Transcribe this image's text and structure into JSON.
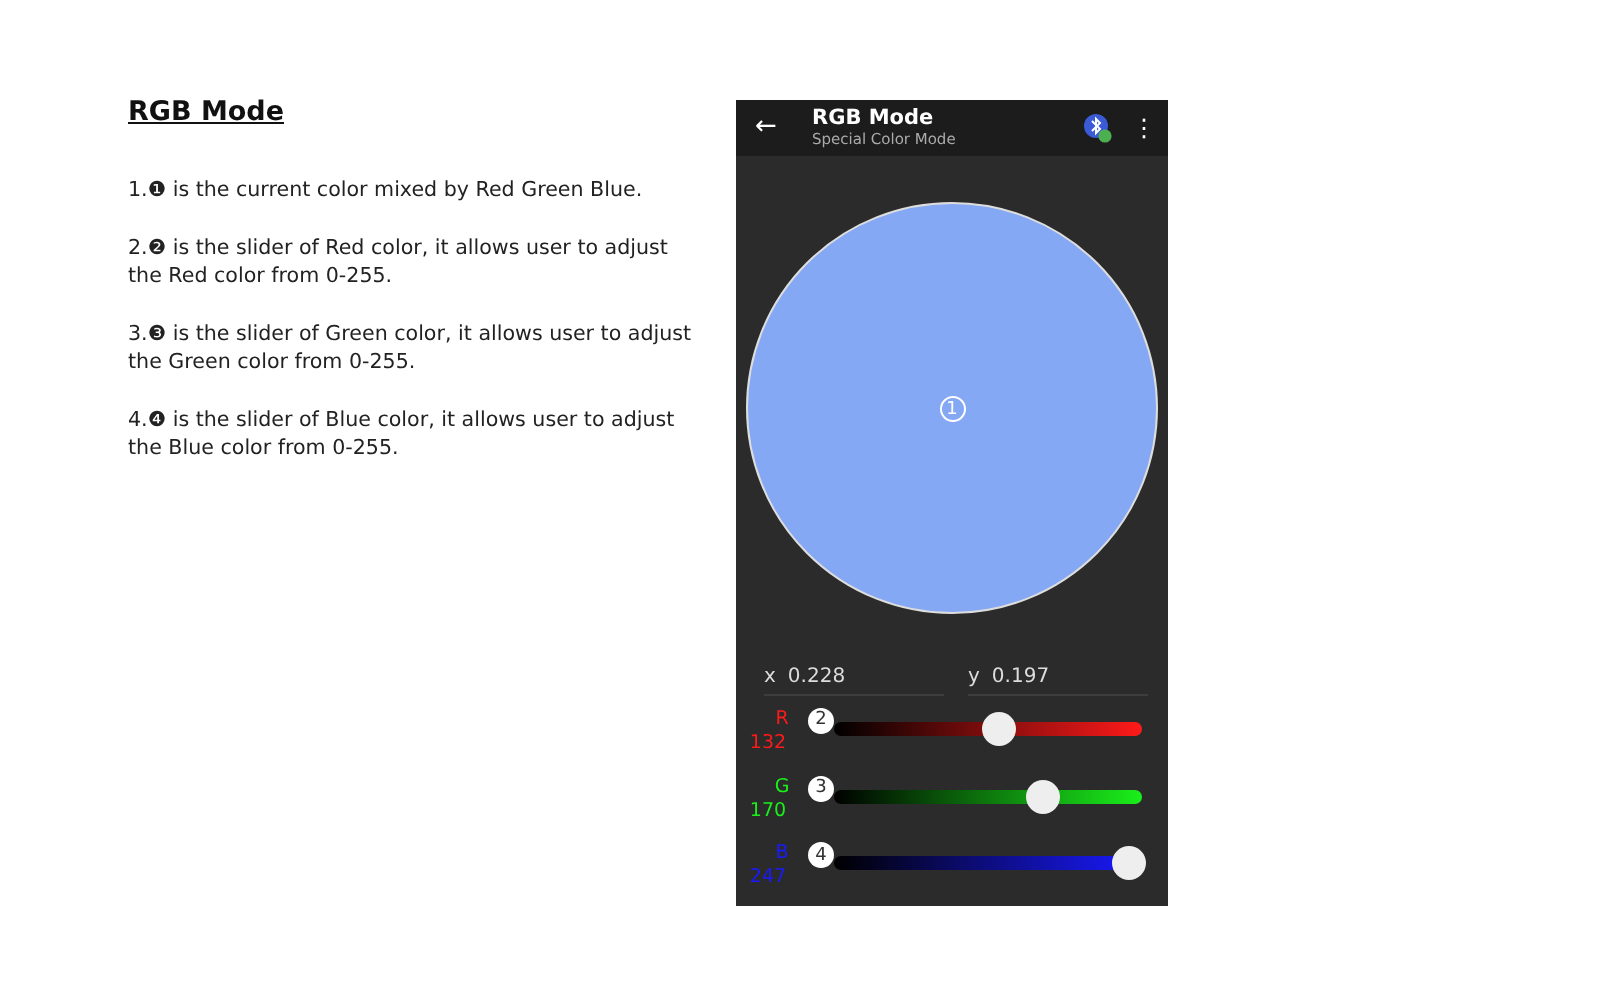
{
  "doc": {
    "title": "RGB Mode",
    "paragraphs": [
      "1.❶ is the current color mixed by Red Green Blue.",
      "2.❷ is the slider of Red color, it allows user to adjust the Red color from 0-255.",
      "3.❸ is the slider of Green color, it allows user to adjust the Green color from 0-255.",
      "4.❹ is the slider of Blue color, it allows user to adjust the Blue color from 0-255."
    ]
  },
  "app": {
    "title": "RGB Mode",
    "subtitle": "Special Color Mode",
    "back": "←",
    "menu": "⋮",
    "preview": {
      "color": "#84a8f4",
      "marker": "1"
    },
    "coords": [
      {
        "label": "x",
        "value": "0.228"
      },
      {
        "label": "y",
        "value": "0.197"
      }
    ],
    "sliders": [
      {
        "label": "R",
        "value": "132",
        "marker": "2",
        "color": "#ff1a1a",
        "level": 0.52
      },
      {
        "label": "G",
        "value": "170",
        "marker": "3",
        "color": "#1aef1a",
        "level": 0.67
      },
      {
        "label": "B",
        "value": "247",
        "marker": "4",
        "color": "#1a1aff",
        "level": 0.97
      }
    ]
  }
}
